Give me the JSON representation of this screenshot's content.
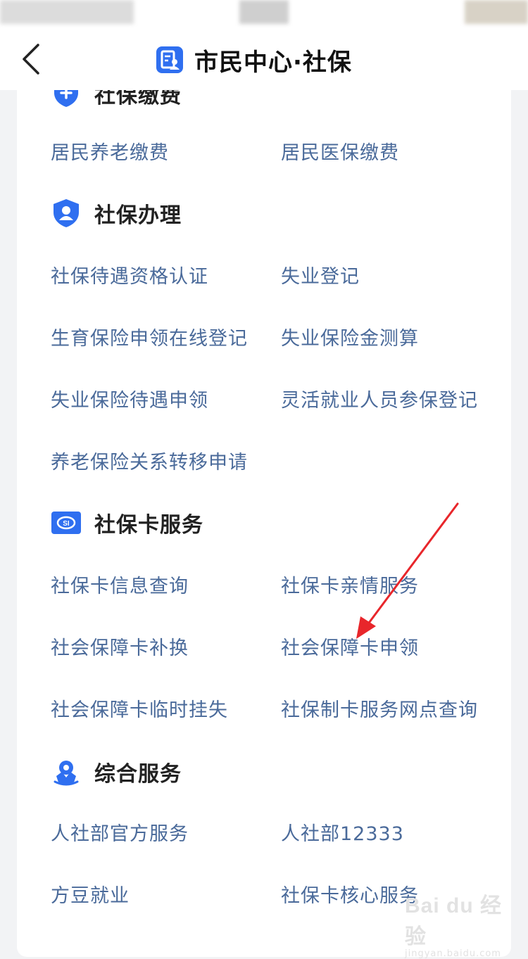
{
  "header": {
    "back_icon": "chevron-left-icon",
    "app_icon": "citizen-center-icon",
    "title": "市民中心·社保"
  },
  "colors": {
    "accent": "#2f6ff0",
    "link_text": "#4a6a9a",
    "annotation_arrow": "#e8262b"
  },
  "sections": {
    "payment": {
      "title": "社保缴费",
      "icon": "shield-plus-icon",
      "items": [
        "居民养老缴费",
        "居民医保缴费"
      ]
    },
    "handling": {
      "title": "社保办理",
      "icon": "shield-user-icon",
      "items": [
        "社保待遇资格认证",
        "失业登记",
        "生育保险申领在线登记",
        "失业保险金测算",
        "失业保险待遇申领",
        "灵活就业人员参保登记",
        "养老保险关系转移申请"
      ]
    },
    "card_service": {
      "title": "社保卡服务",
      "icon": "si-card-icon",
      "items": [
        "社保卡信息查询",
        "社保卡亲情服务",
        "社会保障卡补换",
        "社会保障卡申领",
        "社会保障卡临时挂失",
        "社保制卡服务网点查询"
      ]
    },
    "general": {
      "title": "综合服务",
      "icon": "person-badge-icon",
      "items": [
        "人社部官方服务",
        "人社部12333",
        "方豆就业",
        "社保卡核心服务"
      ]
    }
  },
  "watermark": {
    "main": "Bai du 经验",
    "sub": "jingyan.baidu.com"
  }
}
